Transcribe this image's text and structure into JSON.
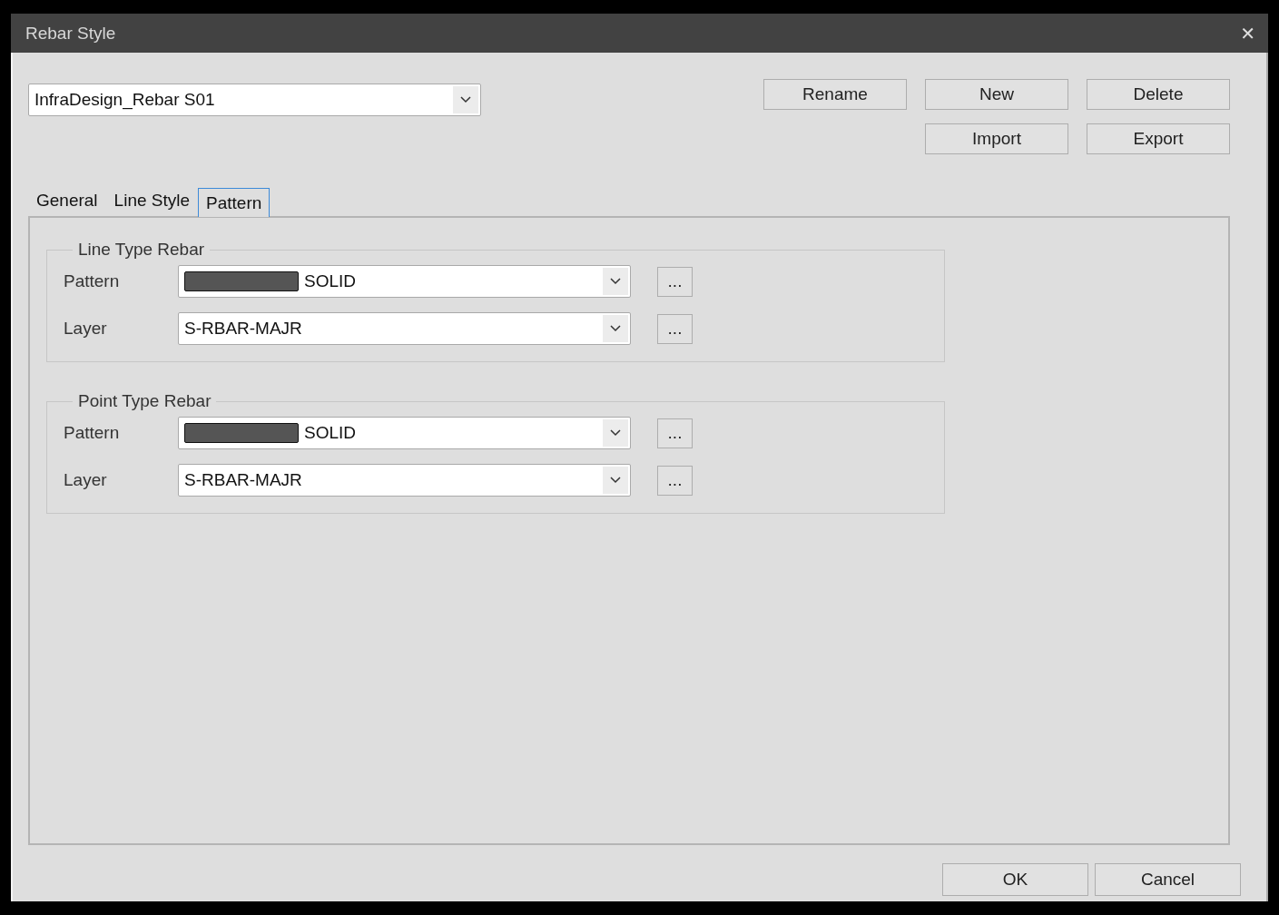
{
  "window": {
    "title": "Rebar Style",
    "close_glyph": "✕"
  },
  "style_select": {
    "value": "InfraDesign_Rebar S01"
  },
  "action_buttons": [
    {
      "label": "Rename"
    },
    {
      "label": "New"
    },
    {
      "label": "Delete"
    },
    {
      "label": "Import"
    },
    {
      "label": "Export"
    }
  ],
  "tabs": [
    {
      "label": "General",
      "selected": false
    },
    {
      "label": "Line Style",
      "selected": false
    },
    {
      "label": "Pattern",
      "selected": true
    }
  ],
  "groups": [
    {
      "title": "Line Type Rebar",
      "rows": [
        {
          "kind": "pattern",
          "label": "Pattern",
          "value": "SOLID",
          "button": "..."
        },
        {
          "kind": "layer",
          "label": "Layer",
          "value": "S-RBAR-MAJR",
          "button": "..."
        }
      ]
    },
    {
      "title": "Point Type Rebar",
      "rows": [
        {
          "kind": "pattern",
          "label": "Pattern",
          "value": "SOLID",
          "button": "..."
        },
        {
          "kind": "layer",
          "label": "Layer",
          "value": "S-RBAR-MAJR",
          "button": "..."
        }
      ]
    }
  ],
  "footer_buttons": [
    {
      "label": "OK"
    },
    {
      "label": "Cancel"
    }
  ]
}
